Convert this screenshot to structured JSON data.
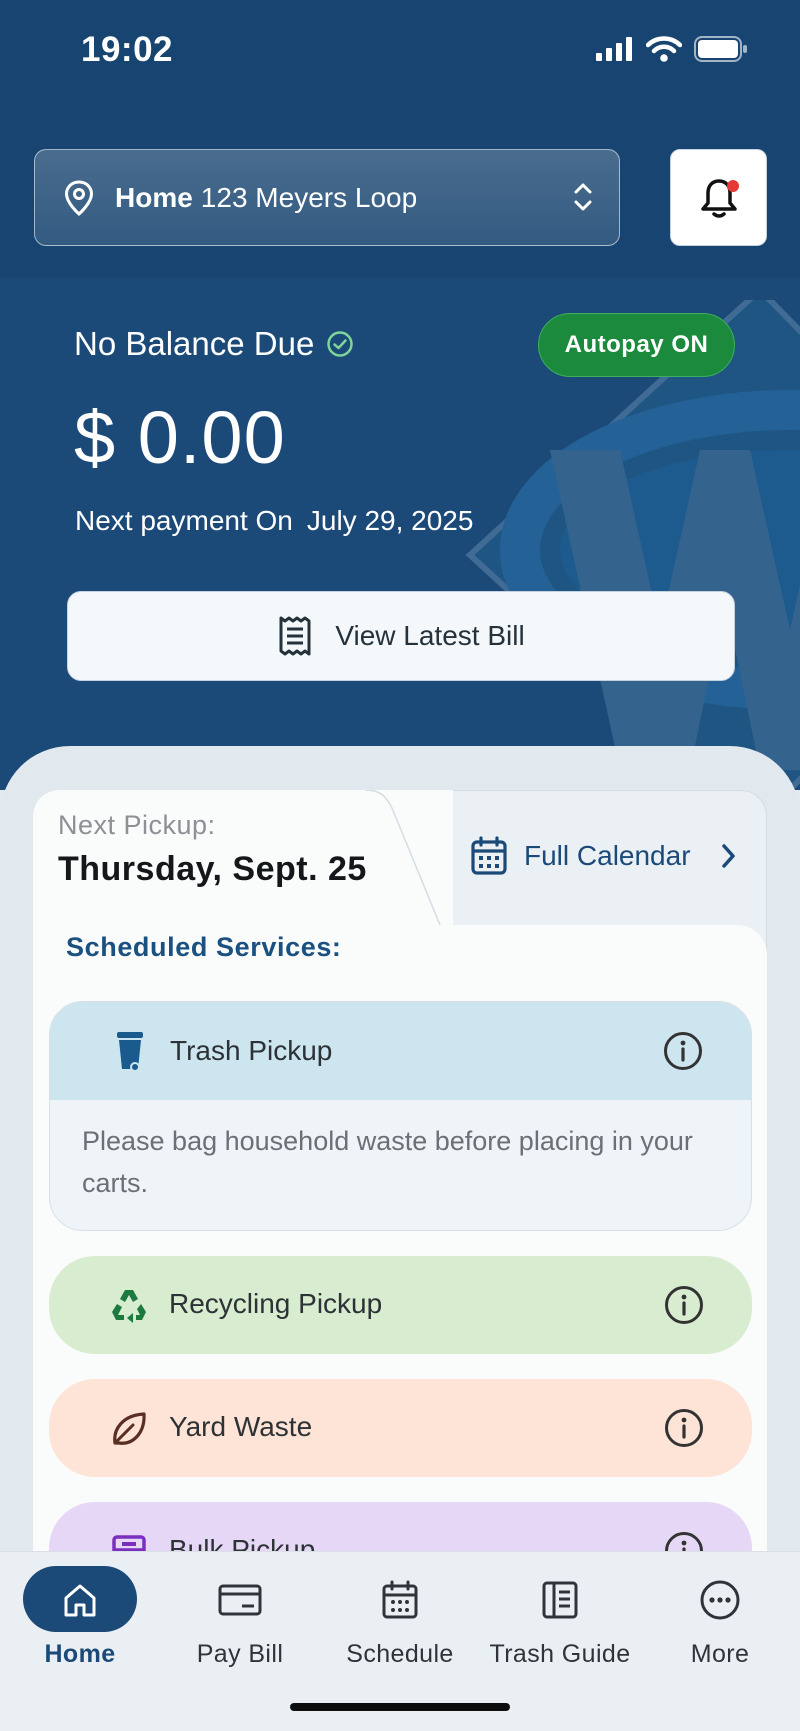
{
  "status_bar": {
    "time": "19:02"
  },
  "location": {
    "name": "Home",
    "address": "123 Meyers Loop"
  },
  "billing": {
    "status": "No Balance Due",
    "autopay": "Autopay ON",
    "amount": "$ 0.00",
    "next_payment_label": "Next payment On",
    "next_payment_date": "July 29, 2025",
    "view_bill_label": "View Latest Bill"
  },
  "pickup": {
    "next_label": "Next Pickup:",
    "next_date": "Thursday, Sept. 25",
    "calendar_link": "Full Calendar",
    "scheduled_title": "Scheduled Services:",
    "services": [
      {
        "label": "Trash Pickup",
        "note": "Please bag household waste before placing in your carts.",
        "icon": "trash-cart-icon",
        "color": "#cde5ef"
      },
      {
        "label": "Recycling Pickup",
        "icon": "recycle-icon",
        "color": "#d8ecd0"
      },
      {
        "label": "Yard Waste",
        "icon": "leaf-icon",
        "color": "#fde4d6"
      },
      {
        "label": "Bulk Pickup",
        "icon": "bulk-icon",
        "color": "#e7d7f6"
      }
    ]
  },
  "nav": [
    {
      "label": "Home",
      "icon": "home-icon",
      "active": true
    },
    {
      "label": "Pay Bill",
      "icon": "credit-card-icon"
    },
    {
      "label": "Schedule",
      "icon": "calendar-icon"
    },
    {
      "label": "Trash Guide",
      "icon": "guide-icon"
    },
    {
      "label": "More",
      "icon": "more-icon"
    }
  ],
  "colors": {
    "primary": "#1b4a78",
    "autopay_green": "#1b8a3d",
    "notification_dot": "#e53935"
  }
}
